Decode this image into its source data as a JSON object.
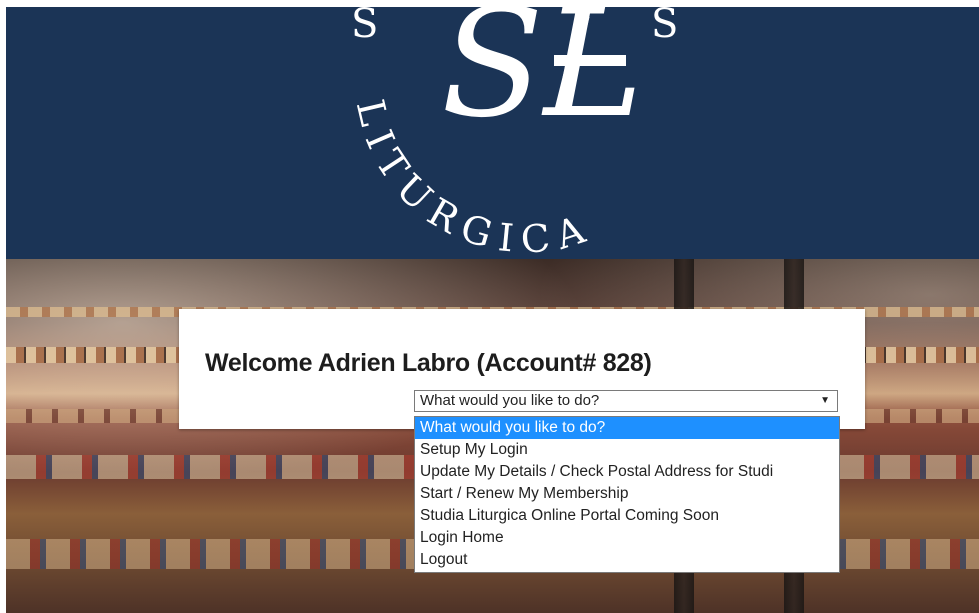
{
  "header": {
    "seal_letters_left": "S",
    "seal_letters_right": "S",
    "seal_arc_text": "LITURGICA",
    "logo_text": "SL"
  },
  "welcome": {
    "title": "Welcome Adrien Labro (Account# 828)"
  },
  "action_select": {
    "selected_value": "What would you like to do?",
    "arrow": "▼",
    "options": [
      "What would you like to do?",
      "Setup My Login",
      "Update My Details / Check Postal Address for Studi",
      "Start / Renew My Membership",
      "Studia Liturgica Online Portal Coming Soon",
      "Login Home",
      "Logout"
    ]
  },
  "colors": {
    "header_bg": "#1b3456",
    "selected_option_bg": "#1e90ff"
  }
}
